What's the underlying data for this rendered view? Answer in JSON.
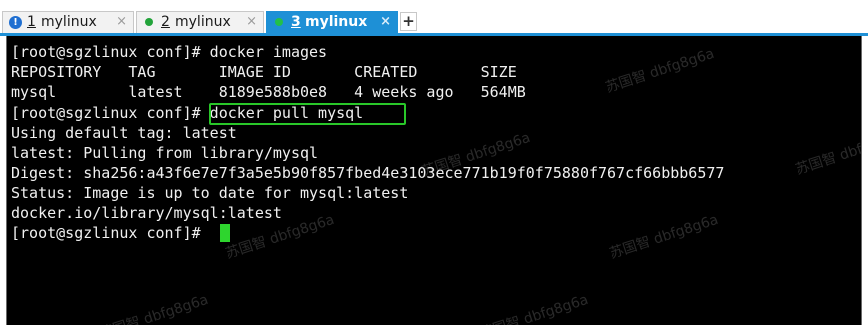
{
  "tabs": [
    {
      "indicator": "!",
      "indicator_type": "warning-icon",
      "number": "1",
      "label": " mylinux",
      "close": "×",
      "active": false
    },
    {
      "indicator": "",
      "indicator_type": "status-dot-icon",
      "number": "2",
      "label": " mylinux",
      "close": "×",
      "active": false
    },
    {
      "indicator": "",
      "indicator_type": "status-dot-icon",
      "number": "3",
      "label": " mylinux",
      "close": "×",
      "active": true
    }
  ],
  "new_tab_label": "+",
  "terminal": {
    "lines": [
      "[root@sgzlinux conf]# docker images",
      "REPOSITORY   TAG       IMAGE ID       CREATED       SIZE",
      "mysql        latest    8189e588b0e8   4 weeks ago   564MB",
      "[root@sgzlinux conf]# docker pull mysql",
      "Using default tag: latest",
      "latest: Pulling from library/mysql",
      "Digest: sha256:a43f6e7e7f3a5e5b90f857fbed4e3103ece771b19f0f75880f767cf66bbb6577",
      "Status: Image is up to date for mysql:latest",
      "docker.io/library/mysql:latest",
      "[root@sgzlinux conf]# "
    ],
    "highlighted_command": "docker pull mysql"
  },
  "watermark": "苏国智 dbfg8g6a",
  "colors": {
    "terminal_bg": "#000000",
    "terminal_fg": "#f0f0f0",
    "cursor": "#2ed52e",
    "highlight_box": "#29c729",
    "active_tab": "#1e90d6",
    "status_dot": "#22a33a"
  }
}
